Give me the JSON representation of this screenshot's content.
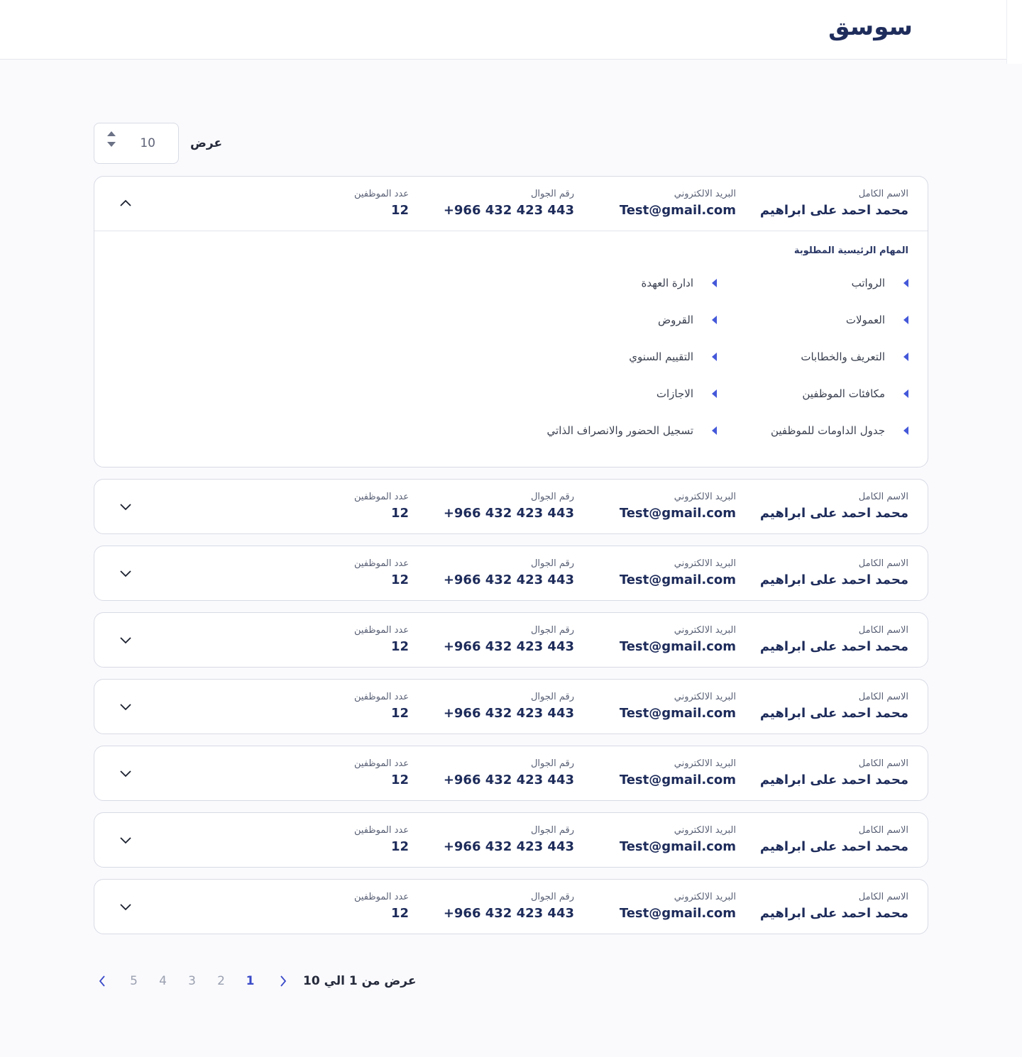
{
  "app": {
    "logo_text": "سوسق"
  },
  "show": {
    "label": "عرض",
    "value": "10"
  },
  "columns": {
    "name_label": "الاسم الكامل",
    "email_label": "البريد الالكتروني",
    "phone_label": "رقم الجوال",
    "count_label": "عدد الموظفين"
  },
  "rows": [
    {
      "name": "محمد احمد على ابراهيم",
      "email": "Test@gmail.com",
      "phone": "+966 432 423 443",
      "count": "12",
      "expanded": true
    },
    {
      "name": "محمد احمد على ابراهيم",
      "email": "Test@gmail.com",
      "phone": "+966 432 423 443",
      "count": "12",
      "expanded": false
    },
    {
      "name": "محمد احمد على ابراهيم",
      "email": "Test@gmail.com",
      "phone": "+966 432 423 443",
      "count": "12",
      "expanded": false
    },
    {
      "name": "محمد احمد على ابراهيم",
      "email": "Test@gmail.com",
      "phone": "+966 432 423 443",
      "count": "12",
      "expanded": false
    },
    {
      "name": "محمد احمد على ابراهيم",
      "email": "Test@gmail.com",
      "phone": "+966 432 423 443",
      "count": "12",
      "expanded": false
    },
    {
      "name": "محمد احمد على ابراهيم",
      "email": "Test@gmail.com",
      "phone": "+966 432 423 443",
      "count": "12",
      "expanded": false
    },
    {
      "name": "محمد احمد على ابراهيم",
      "email": "Test@gmail.com",
      "phone": "+966 432 423 443",
      "count": "12",
      "expanded": false
    },
    {
      "name": "محمد احمد على ابراهيم",
      "email": "Test@gmail.com",
      "phone": "+966 432 423 443",
      "count": "12",
      "expanded": false
    }
  ],
  "details": {
    "title": "المهام الرئيسية المطلوبة",
    "tasks_right": [
      "الرواتب",
      "العمولات",
      "التعريف والخطابات",
      "مكافئات الموظفين",
      "جدول الداومات للموظفين"
    ],
    "tasks_left": [
      "ادارة العهدة",
      "القروض",
      "التقييم السنوي",
      "الاجازات",
      "تسجيل الحضور والانصراف الذاتي"
    ]
  },
  "pagination": {
    "summary": "عرض  من 1 الي 10",
    "pages": [
      "1",
      "2",
      "3",
      "4",
      "5"
    ],
    "current": "1"
  },
  "colors": {
    "accent": "#3a4ac8",
    "text_dark": "#1d2b5a",
    "border": "#d8dbe5"
  }
}
